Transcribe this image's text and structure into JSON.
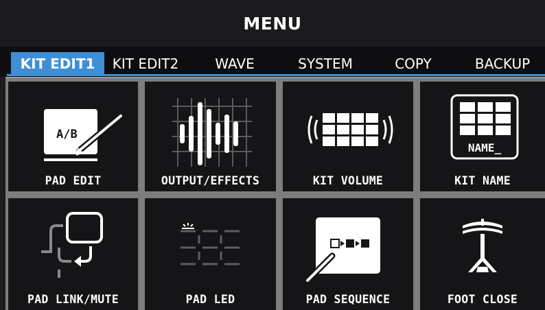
{
  "header": {
    "title": "MENU"
  },
  "tabs": [
    {
      "label": "KIT EDIT1",
      "active": true
    },
    {
      "label": "KIT EDIT2",
      "active": false
    },
    {
      "label": "WAVE",
      "active": false
    },
    {
      "label": "SYSTEM",
      "active": false
    },
    {
      "label": "COPY",
      "active": false
    },
    {
      "label": "BACKUP",
      "active": false
    }
  ],
  "tiles": [
    {
      "label": "PAD EDIT",
      "icon": "pad-edit-icon",
      "icon_text": "A/B"
    },
    {
      "label": "OUTPUT/EFFECTS",
      "icon": "output-effects-icon"
    },
    {
      "label": "KIT VOLUME",
      "icon": "kit-volume-icon"
    },
    {
      "label": "KIT NAME",
      "icon": "kit-name-icon",
      "icon_text": "NAME_"
    },
    {
      "label": "PAD LINK/MUTE",
      "icon": "pad-link-mute-icon"
    },
    {
      "label": "PAD LED",
      "icon": "pad-led-icon"
    },
    {
      "label": "PAD SEQUENCE",
      "icon": "pad-sequence-icon"
    },
    {
      "label": "FOOT CLOSE",
      "icon": "foot-close-icon"
    }
  ],
  "colors": {
    "accent": "#3f8fd6",
    "tile_bg": "#151517",
    "header_bg": "#1b1b1d"
  }
}
